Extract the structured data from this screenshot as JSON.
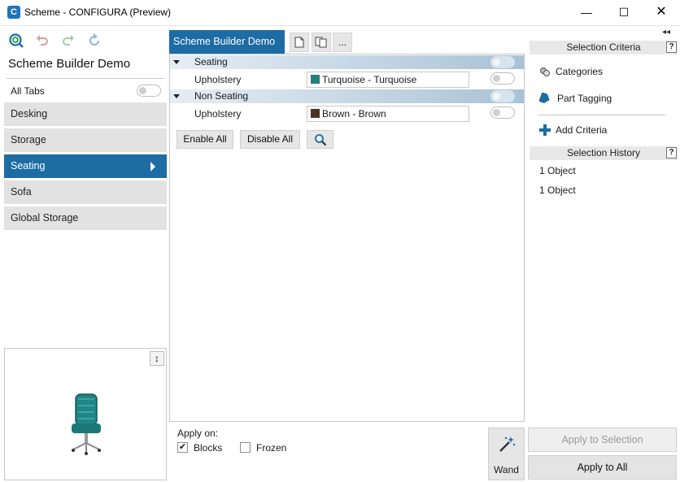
{
  "window": {
    "title": "Scheme - CONFIGURA (Preview)",
    "icon_letter": "C",
    "controls": {
      "minimize": "—",
      "maximize": "☐",
      "close": "✕"
    }
  },
  "left_panel": {
    "title": "Scheme Builder Demo",
    "toolbar": [
      "zoom-search-icon",
      "undo-icon",
      "redo-icon",
      "refresh-icon"
    ],
    "all_tabs_label": "All Tabs",
    "tabs": [
      {
        "label": "Desking",
        "active": false
      },
      {
        "label": "Storage",
        "active": false
      },
      {
        "label": "Seating",
        "active": true
      },
      {
        "label": "Sofa",
        "active": false
      },
      {
        "label": "Global Storage",
        "active": false
      }
    ],
    "preview_resize_glyph": "↕"
  },
  "center": {
    "tab_label": "Scheme Builder Demo",
    "tool_more": "...",
    "groups": [
      {
        "name": "Seating",
        "items": [
          {
            "label": "Upholstery",
            "value": "Turquoise - Turquoise",
            "swatch": "#2a7d7d"
          }
        ]
      },
      {
        "name": "Non Seating",
        "items": [
          {
            "label": "Upholstery",
            "value": "Brown - Brown",
            "swatch": "#4a3323"
          }
        ]
      }
    ],
    "buttons": {
      "enable_all": "Enable All",
      "disable_all": "Disable All"
    },
    "apply_on": {
      "label": "Apply on:",
      "blocks": {
        "label": "Blocks",
        "checked": true
      },
      "frozen": {
        "label": "Frozen",
        "checked": false
      }
    },
    "wand_label": "Wand"
  },
  "right_panel": {
    "collapse_glyph": "◂◂",
    "selection_criteria": {
      "header": "Selection Criteria",
      "items": [
        "Categories",
        "Part Tagging"
      ],
      "add_criteria": "Add Criteria"
    },
    "selection_history": {
      "header": "Selection History",
      "items": [
        "1 Object",
        "1 Object"
      ]
    },
    "help_glyph": "?",
    "apply_to_selection": "Apply to Selection",
    "apply_to_all": "Apply to All"
  },
  "colors": {
    "accent": "#1d6ca3",
    "tab_bg": "#e2e2e2"
  }
}
